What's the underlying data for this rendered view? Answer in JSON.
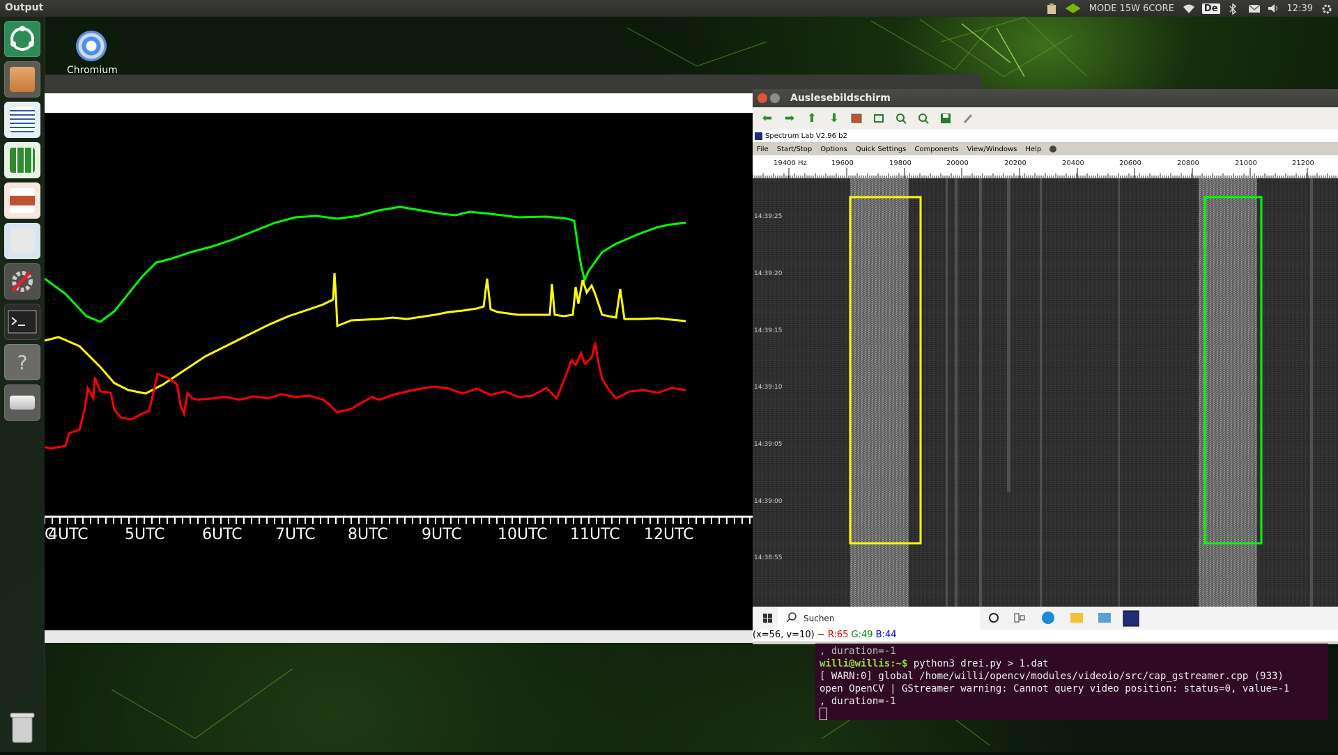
{
  "topbar": {
    "app_name": "Output",
    "nvidia_mode": "MODE 15W 6CORE",
    "keyboard_layout": "De",
    "clock": "12:39",
    "icons": [
      "clipboard-icon",
      "nvidia-icon",
      "wifi-icon",
      "keyboard-icon",
      "bluetooth-icon",
      "mail-icon",
      "volume-icon",
      "power-gear-icon"
    ]
  },
  "launcher": {
    "items": [
      "ubuntu-dash-icon",
      "files-icon",
      "writer-icon",
      "calc-icon",
      "impress-icon",
      "software-icon",
      "settings-icon",
      "terminal-icon",
      "help-icon",
      "drive-icon",
      "trash-icon"
    ]
  },
  "desktop": {
    "icon_label": "Chromium"
  },
  "graph_window": {
    "x_ticks": [
      "C",
      "4UTC",
      "5UTC",
      "6UTC",
      "7UTC",
      "8UTC",
      "9UTC",
      "10UTC",
      "11UTC",
      "12UTC"
    ],
    "series_colors": {
      "green": "#00ff00",
      "yellow": "#ffff00",
      "red": "#ff0000"
    }
  },
  "spectrum_window": {
    "title": "Auslesebildschirm",
    "toolbar_icons": [
      "back-arrow-icon",
      "forward-arrow-icon",
      "up-arrow-icon",
      "down-arrow-icon",
      "image-icon",
      "fit-icon",
      "zoom-in-icon",
      "zoom-out-icon",
      "save-icon",
      "brush-icon"
    ],
    "app_title": "Spectrum Lab V2.96 b2",
    "menu": [
      "File",
      "Start/Stop",
      "Options",
      "Quick Settings",
      "Components",
      "View/Windows",
      "Help"
    ],
    "freq_labels": [
      "19400 Hz",
      "19600",
      "19800",
      "20000",
      "20200",
      "20400",
      "20600",
      "20800",
      "21000",
      "21200"
    ],
    "time_labels": [
      "14:39:25",
      "14:39:20",
      "14:39:15",
      "14:39:10",
      "14:39:05",
      "14:39:00",
      "14:38:55"
    ],
    "boxes": {
      "yellow": "#ffff00",
      "green": "#00ff00"
    },
    "taskbar": {
      "search_placeholder": "Suchen",
      "icons": [
        "windows-start-icon",
        "search-icon",
        "cortana-icon",
        "task-view-icon",
        "edge-icon",
        "explorer-icon",
        "network-icon",
        "spectrumlab-icon"
      ]
    },
    "status": {
      "coords": "(x=56, v=10) ~ ",
      "r": "R:65",
      "g": "G:49",
      "b": "B:44"
    }
  },
  "terminal": {
    "line1": ", duration=-1",
    "prompt": "willi@willis:~$",
    "command": " python3 drei.py > 1.dat",
    "line3": "[ WARN:0] global /home/willi/opencv/modules/videoio/src/cap_gstreamer.cpp (933)",
    "line4": "open OpenCV | GStreamer warning: Cannot query video position: status=0, value=-1",
    "line5": ", duration=-1"
  }
}
